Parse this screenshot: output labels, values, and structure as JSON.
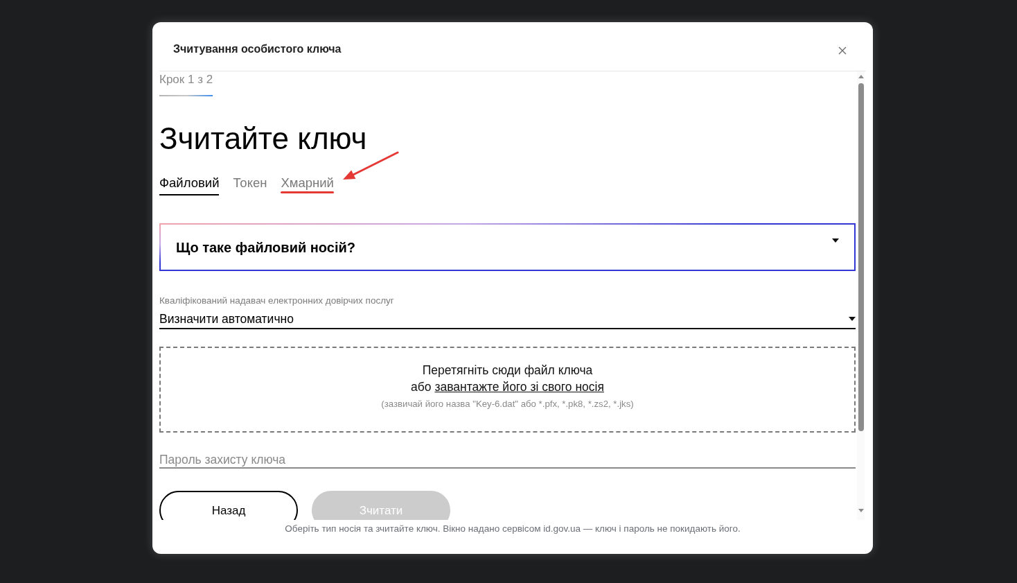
{
  "dialog": {
    "title": "Зчитування особистого ключа"
  },
  "step": {
    "label": "Крок 1 з 2"
  },
  "heading": "Зчитайте ключ",
  "tabs": [
    {
      "label": "Файловий",
      "selected": true,
      "annotated": false
    },
    {
      "label": "Токен",
      "selected": false,
      "annotated": false
    },
    {
      "label": "Хмарний",
      "selected": false,
      "annotated": true
    }
  ],
  "accordion": {
    "title": "Що таке файловий носій?",
    "expanded": false
  },
  "provider_select": {
    "label": "Кваліфікований надавач електронних довірчих послуг",
    "value": "Визначити автоматично"
  },
  "dropzone": {
    "instruction": "Перетягніть сюди файл ключа",
    "prefix": "або",
    "link": "завантажте його зі свого носія",
    "hint": "(зазвичай його назва \"Key-6.dat\" або *.pfx, *.pk8, *.zs2, *.jks)"
  },
  "password": {
    "placeholder": "Пароль захисту ключа"
  },
  "buttons": [
    {
      "label": "Назад",
      "kind": "outline",
      "disabled": false
    },
    {
      "label": "Зчитати",
      "kind": "primary",
      "disabled": true
    }
  ],
  "footer_note": "Оберіть тип носія та зчитайте ключ. Вікно надано сервісом id.gov.ua — ключ і пароль не покидають його."
}
